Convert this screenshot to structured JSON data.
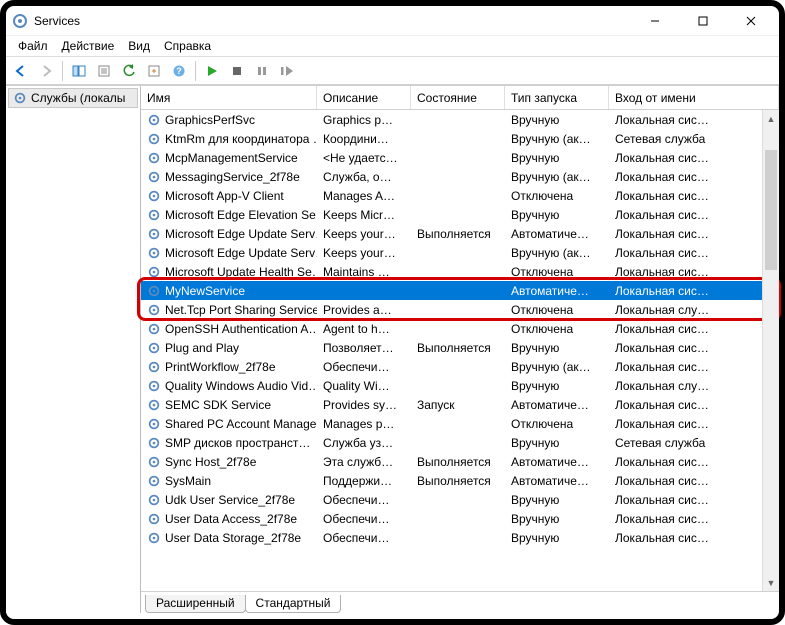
{
  "title": "Services",
  "menus": [
    "Файл",
    "Действие",
    "Вид",
    "Справка"
  ],
  "sidebar": {
    "label": "Службы (локалы"
  },
  "columns": [
    "Имя",
    "Описание",
    "Состояние",
    "Тип запуска",
    "Вход от имени"
  ],
  "tabs": {
    "extended": "Расширенный",
    "standard": "Стандартный"
  },
  "selectedIndex": 9,
  "rows": [
    {
      "name": "GraphicsPerfSvc",
      "desc": "Graphics p…",
      "state": "",
      "start": "Вручную",
      "logon": "Локальная сис…"
    },
    {
      "name": "KtmRm для координатора …",
      "desc": "Координи…",
      "state": "",
      "start": "Вручную (ак…",
      "logon": "Сетевая служба"
    },
    {
      "name": "McpManagementService",
      "desc": "<Не удаетс…",
      "state": "",
      "start": "Вручную",
      "logon": "Локальная сис…"
    },
    {
      "name": "MessagingService_2f78e",
      "desc": "Служба, о…",
      "state": "",
      "start": "Вручную (ак…",
      "logon": "Локальная сис…"
    },
    {
      "name": "Microsoft App-V Client",
      "desc": "Manages A…",
      "state": "",
      "start": "Отключена",
      "logon": "Локальная сис…"
    },
    {
      "name": "Microsoft Edge Elevation Se…",
      "desc": "Keeps Micr…",
      "state": "",
      "start": "Вручную",
      "logon": "Локальная сис…"
    },
    {
      "name": "Microsoft Edge Update Serv…",
      "desc": "Keeps your…",
      "state": "Выполняется",
      "start": "Автоматиче…",
      "logon": "Локальная сис…"
    },
    {
      "name": "Microsoft Edge Update Serv…",
      "desc": "Keeps your…",
      "state": "",
      "start": "Вручную (ак…",
      "logon": "Локальная сис…"
    },
    {
      "name": "Microsoft Update Health Se…",
      "desc": "Maintains …",
      "state": "",
      "start": "Отключена",
      "logon": "Локальная сис…"
    },
    {
      "name": "MyNewService",
      "desc": "",
      "state": "",
      "start": "Автоматиче…",
      "logon": "Локальная сис…"
    },
    {
      "name": "Net.Tcp Port Sharing Service",
      "desc": "Provides a…",
      "state": "",
      "start": "Отключена",
      "logon": "Локальная слу…"
    },
    {
      "name": "OpenSSH Authentication A…",
      "desc": "Agent to h…",
      "state": "",
      "start": "Отключена",
      "logon": "Локальная сис…"
    },
    {
      "name": "Plug and Play",
      "desc": "Позволяет…",
      "state": "Выполняется",
      "start": "Вручную",
      "logon": "Локальная сис…"
    },
    {
      "name": "PrintWorkflow_2f78e",
      "desc": "Обеспечи…",
      "state": "",
      "start": "Вручную (ак…",
      "logon": "Локальная сис…"
    },
    {
      "name": "Quality Windows Audio Vid…",
      "desc": "Quality Wi…",
      "state": "",
      "start": "Вручную",
      "logon": "Локальная слу…"
    },
    {
      "name": "SEMC SDK Service",
      "desc": "Provides sy…",
      "state": "Запуск",
      "start": "Автоматиче…",
      "logon": "Локальная сис…"
    },
    {
      "name": "Shared PC Account Manager",
      "desc": "Manages p…",
      "state": "",
      "start": "Отключена",
      "logon": "Локальная сис…"
    },
    {
      "name": "SMP дисков пространст…",
      "desc": "Служба уз…",
      "state": "",
      "start": "Вручную",
      "logon": "Сетевая служба"
    },
    {
      "name": "Sync Host_2f78e",
      "desc": "Эта служб…",
      "state": "Выполняется",
      "start": "Автоматиче…",
      "logon": "Локальная сис…"
    },
    {
      "name": "SysMain",
      "desc": "Поддержи…",
      "state": "Выполняется",
      "start": "Автоматиче…",
      "logon": "Локальная сис…"
    },
    {
      "name": "Udk User Service_2f78e",
      "desc": "Обеспечи…",
      "state": "",
      "start": "Вручную",
      "logon": "Локальная сис…"
    },
    {
      "name": "User Data Access_2f78e",
      "desc": "Обеспечи…",
      "state": "",
      "start": "Вручную",
      "logon": "Локальная сис…"
    },
    {
      "name": "User Data Storage_2f78e",
      "desc": "Обеспечи…",
      "state": "",
      "start": "Вручную",
      "logon": "Локальная сис…"
    }
  ]
}
